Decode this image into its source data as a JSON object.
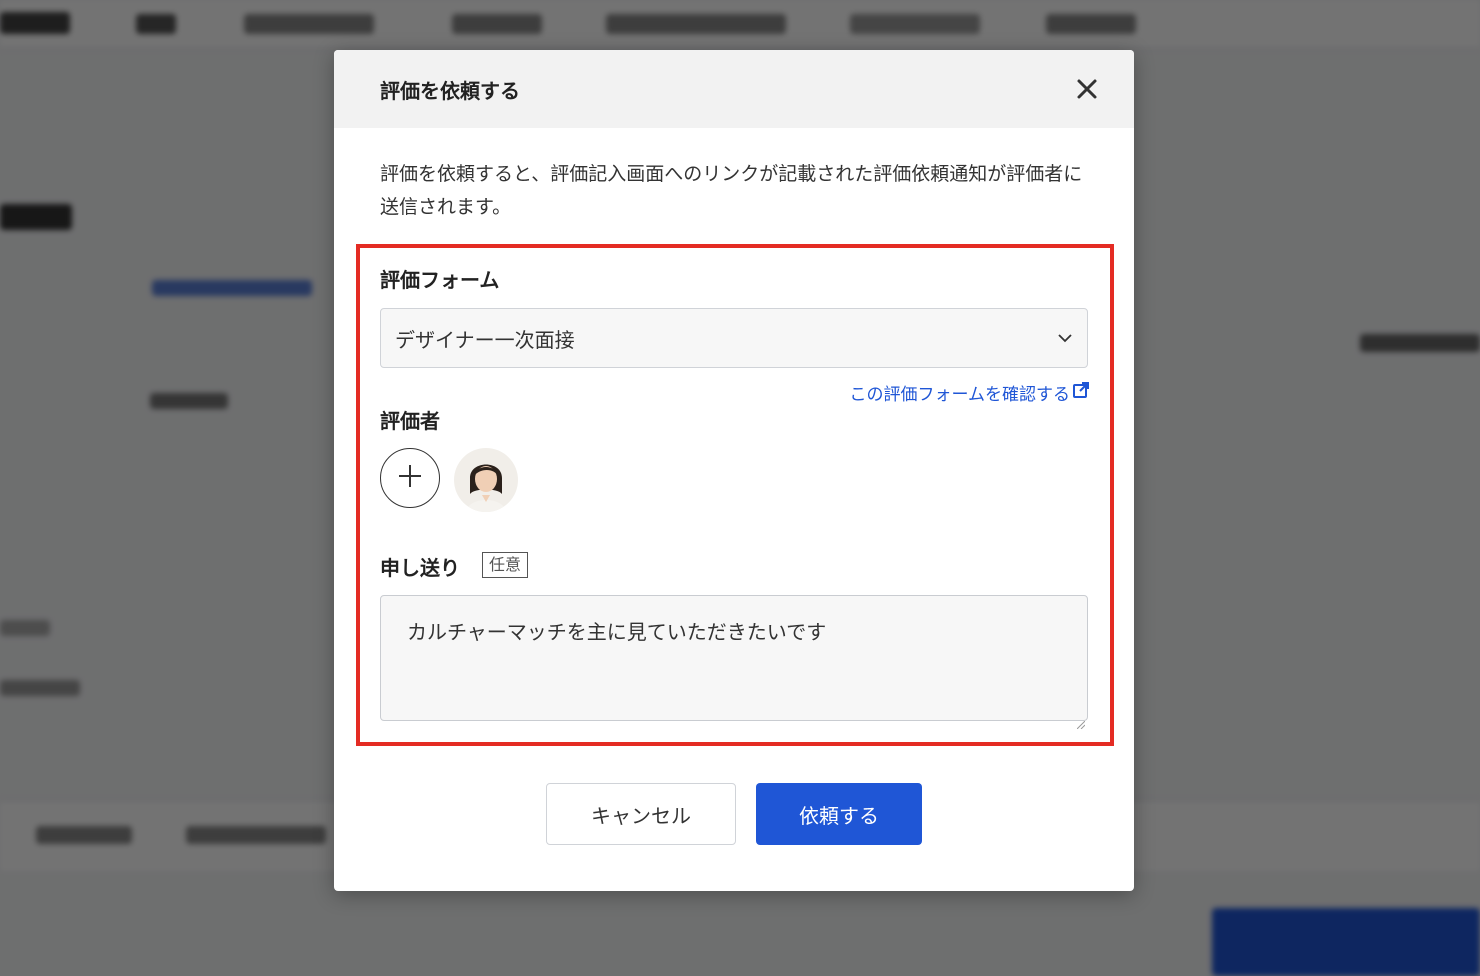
{
  "modal": {
    "title": "評価を依頼する",
    "description": "評価を依頼すると、評価記入画面へのリンクが記載された評価依頼通知が評価者に送信されます。",
    "evaluation_form": {
      "label": "評価フォーム",
      "selected_value": "デザイナー一次面接",
      "confirm_link": "この評価フォームを確認する"
    },
    "evaluators": {
      "label": "評価者"
    },
    "handover": {
      "label": "申し送り",
      "optional_badge": "任意",
      "value": "カルチャーマッチを主に見ていただきたいです"
    },
    "buttons": {
      "cancel": "キャンセル",
      "submit": "依頼する"
    }
  },
  "colors": {
    "primary": "#1f56d6",
    "highlight_border": "#e42b23",
    "overlay": "rgba(0,0,0,0.55)"
  }
}
